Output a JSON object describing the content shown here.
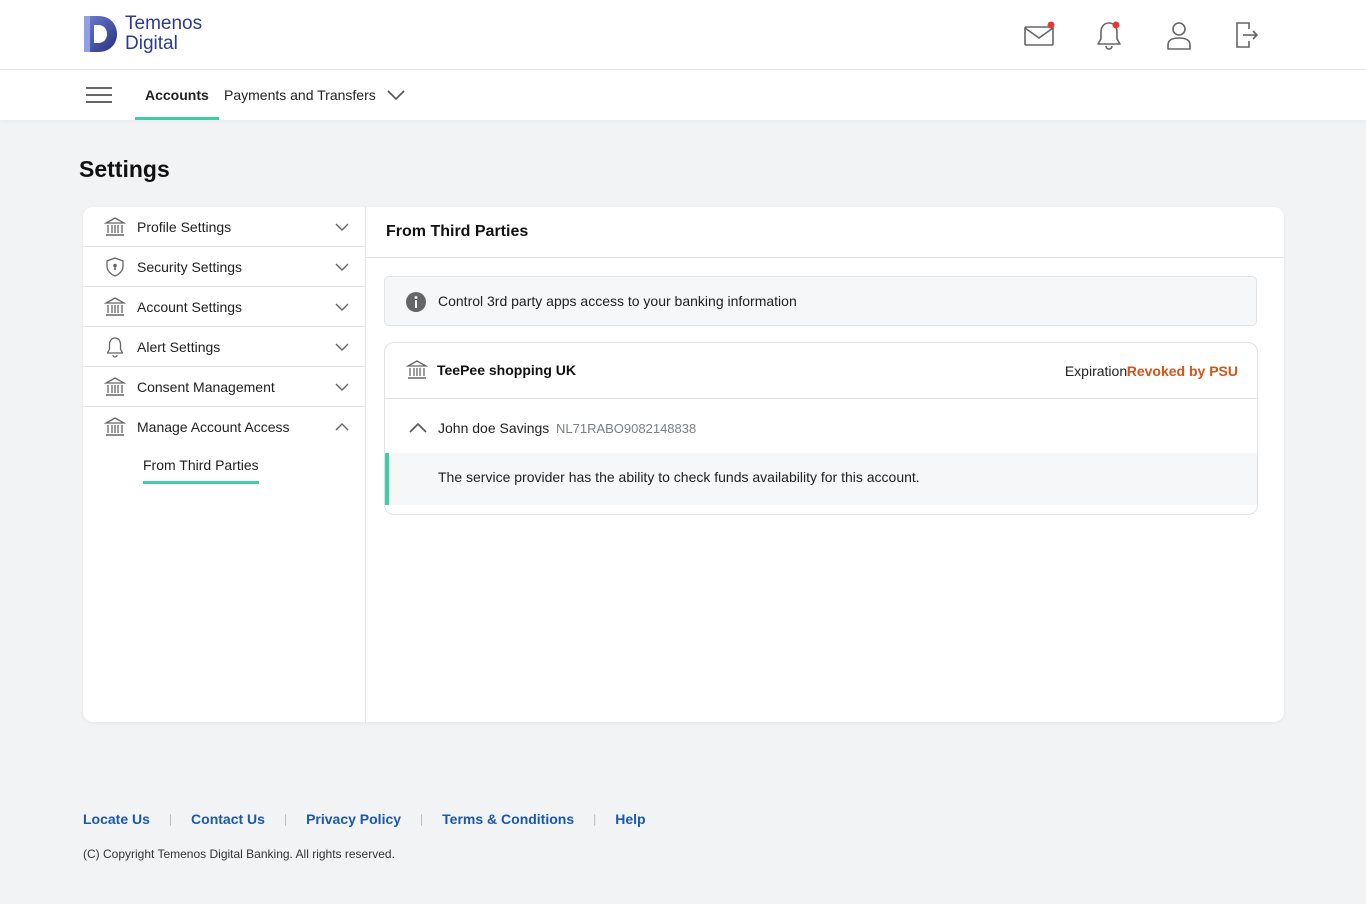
{
  "brand": {
    "line1": "Temenos",
    "line2": "Digital"
  },
  "nav": {
    "tabs": [
      {
        "label": "Accounts",
        "active": true
      },
      {
        "label": "Payments and Transfers",
        "active": false
      }
    ]
  },
  "page": {
    "title": "Settings"
  },
  "sidebar": {
    "items": [
      {
        "label": "Profile Settings",
        "icon": "bank-icon",
        "expanded": false
      },
      {
        "label": "Security Settings",
        "icon": "shield-icon",
        "expanded": false
      },
      {
        "label": "Account Settings",
        "icon": "bank-icon",
        "expanded": false
      },
      {
        "label": "Alert Settings",
        "icon": "bell-icon",
        "expanded": false
      },
      {
        "label": "Consent Management",
        "icon": "bank-icon",
        "expanded": false
      },
      {
        "label": "Manage Account Access",
        "icon": "bank-icon",
        "expanded": true
      }
    ],
    "sub_item": "From Third Parties"
  },
  "content": {
    "heading": "From Third Parties",
    "info": "Control 3rd party apps access to your banking information",
    "third_party": {
      "name": "TeePee shopping UK",
      "expiration_label": "Expiration:",
      "expiration_value": "Revoked by PSU",
      "account_name": "John doe Savings",
      "account_iban": "NL71RABO9082148838",
      "permission": "The service provider has the ability to check funds availability for this account."
    }
  },
  "footer": {
    "links": [
      "Locate Us",
      "Contact Us",
      "Privacy Policy",
      "Terms & Conditions",
      "Help"
    ],
    "copyright": "(C) Copyright Temenos Digital Banking. All rights reserved."
  },
  "colors": {
    "accent": "#3fcca6",
    "brand": "#2e3a8c",
    "link": "#1b58a8",
    "revoked": "#d2541a",
    "notification": "#e53935"
  }
}
